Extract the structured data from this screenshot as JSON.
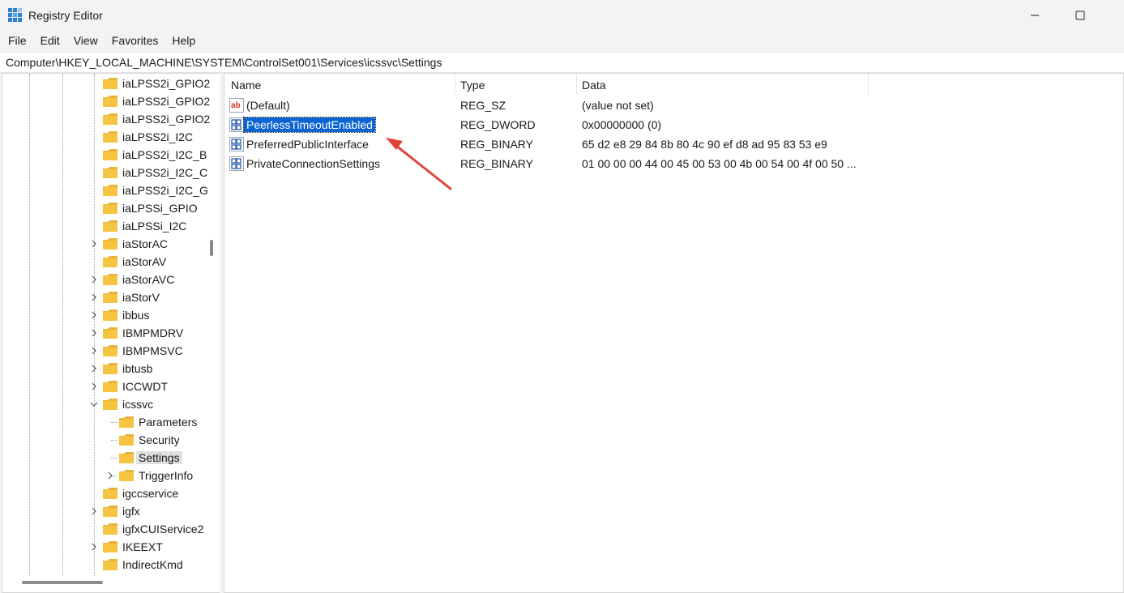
{
  "window": {
    "title": "Registry Editor",
    "minimize_glyph": "—",
    "maximize_glyph": "□"
  },
  "menu": [
    "File",
    "Edit",
    "View",
    "Favorites",
    "Help"
  ],
  "address": "Computer\\HKEY_LOCAL_MACHINE\\SYSTEM\\ControlSet001\\Services\\icssvc\\Settings",
  "tree": {
    "items": [
      {
        "label": "iaLPSS2i_GPIO2",
        "expandable": false,
        "level": 0
      },
      {
        "label": "iaLPSS2i_GPIO2",
        "expandable": false,
        "level": 0
      },
      {
        "label": "iaLPSS2i_GPIO2",
        "expandable": false,
        "level": 0
      },
      {
        "label": "iaLPSS2i_I2C",
        "expandable": false,
        "level": 0
      },
      {
        "label": "iaLPSS2i_I2C_B",
        "expandable": false,
        "level": 0
      },
      {
        "label": "iaLPSS2i_I2C_C",
        "expandable": false,
        "level": 0
      },
      {
        "label": "iaLPSS2i_I2C_G",
        "expandable": false,
        "level": 0
      },
      {
        "label": "iaLPSSi_GPIO",
        "expandable": false,
        "level": 0
      },
      {
        "label": "iaLPSSi_I2C",
        "expandable": false,
        "level": 0
      },
      {
        "label": "iaStorAC",
        "expandable": true,
        "level": 0
      },
      {
        "label": "iaStorAV",
        "expandable": false,
        "level": 0
      },
      {
        "label": "iaStorAVC",
        "expandable": true,
        "level": 0
      },
      {
        "label": "iaStorV",
        "expandable": true,
        "level": 0
      },
      {
        "label": "ibbus",
        "expandable": true,
        "level": 0
      },
      {
        "label": "IBMPMDRV",
        "expandable": true,
        "level": 0
      },
      {
        "label": "IBMPMSVC",
        "expandable": true,
        "level": 0
      },
      {
        "label": "ibtusb",
        "expandable": true,
        "level": 0
      },
      {
        "label": "ICCWDT",
        "expandable": true,
        "level": 0
      },
      {
        "label": "icssvc",
        "expandable": true,
        "expanded": true,
        "level": 0
      },
      {
        "label": "Parameters",
        "expandable": false,
        "level": 1
      },
      {
        "label": "Security",
        "expandable": false,
        "level": 1
      },
      {
        "label": "Settings",
        "expandable": false,
        "level": 1,
        "selected": true
      },
      {
        "label": "TriggerInfo",
        "expandable": true,
        "level": 1
      },
      {
        "label": "igccservice",
        "expandable": false,
        "level": 0
      },
      {
        "label": "igfx",
        "expandable": true,
        "level": 0
      },
      {
        "label": "igfxCUIService2",
        "expandable": false,
        "level": 0
      },
      {
        "label": "IKEEXT",
        "expandable": true,
        "level": 0
      },
      {
        "label": "IndirectKmd",
        "expandable": false,
        "level": 0
      }
    ]
  },
  "list": {
    "columns": {
      "name": "Name",
      "type": "Type",
      "data": "Data"
    },
    "rows": [
      {
        "name": "(Default)",
        "type": "REG_SZ",
        "data": "(value not set)",
        "icon": "string-value-icon"
      },
      {
        "name": "PeerlessTimeoutEnabled",
        "type": "REG_DWORD",
        "data": "0x00000000 (0)",
        "icon": "binary-value-icon",
        "selected": true
      },
      {
        "name": "PreferredPublicInterface",
        "type": "REG_BINARY",
        "data": "65 d2 e8 29 84 8b 80 4c 90 ef d8 ad 95 83 53 e9",
        "icon": "binary-value-icon"
      },
      {
        "name": "PrivateConnectionSettings",
        "type": "REG_BINARY",
        "data": "01 00 00 00 44 00 45 00 53 00 4b 00 54 00 4f 00 50 ...",
        "icon": "binary-value-icon"
      }
    ]
  },
  "annotation": {
    "color": "#e0433a"
  },
  "colors": {
    "selection": "#0a64d2",
    "folder": "#f5c542"
  }
}
